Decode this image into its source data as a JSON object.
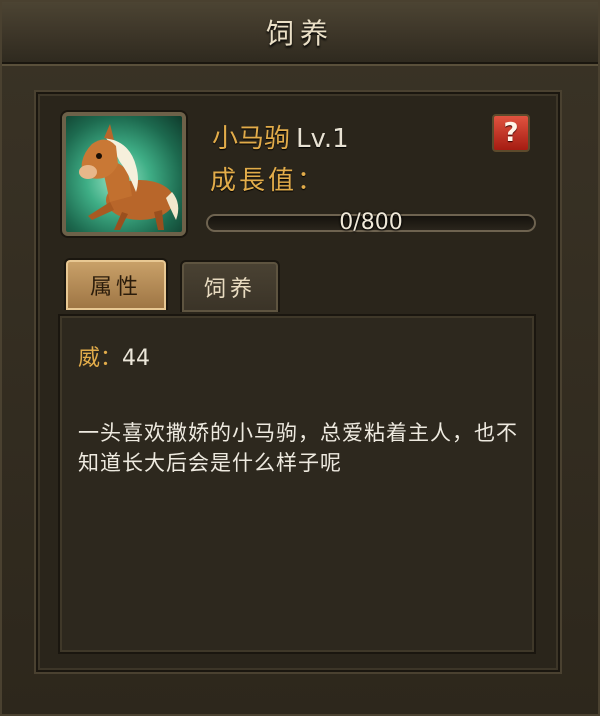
{
  "window": {
    "title": "饲养"
  },
  "pet": {
    "name": "小马驹",
    "level": "Lv.1",
    "growth_label": "成長值：",
    "progress": {
      "current": 0,
      "max": 800,
      "text": "0/800"
    },
    "portrait_icon": "foal-icon"
  },
  "help_button": {
    "label": "?",
    "color": "#c8321f"
  },
  "tabs": [
    {
      "label": "属性",
      "active": true
    },
    {
      "label": "饲养",
      "active": false
    }
  ],
  "attributes": {
    "stat_label": "威：",
    "stat_value": "44",
    "description": "一头喜欢撒娇的小马驹，总爱粘着主人，也不知道长大后会是什么样子呢"
  },
  "colors": {
    "accent_gold": "#e2ac4a",
    "panel_brown": "#2d281e"
  }
}
